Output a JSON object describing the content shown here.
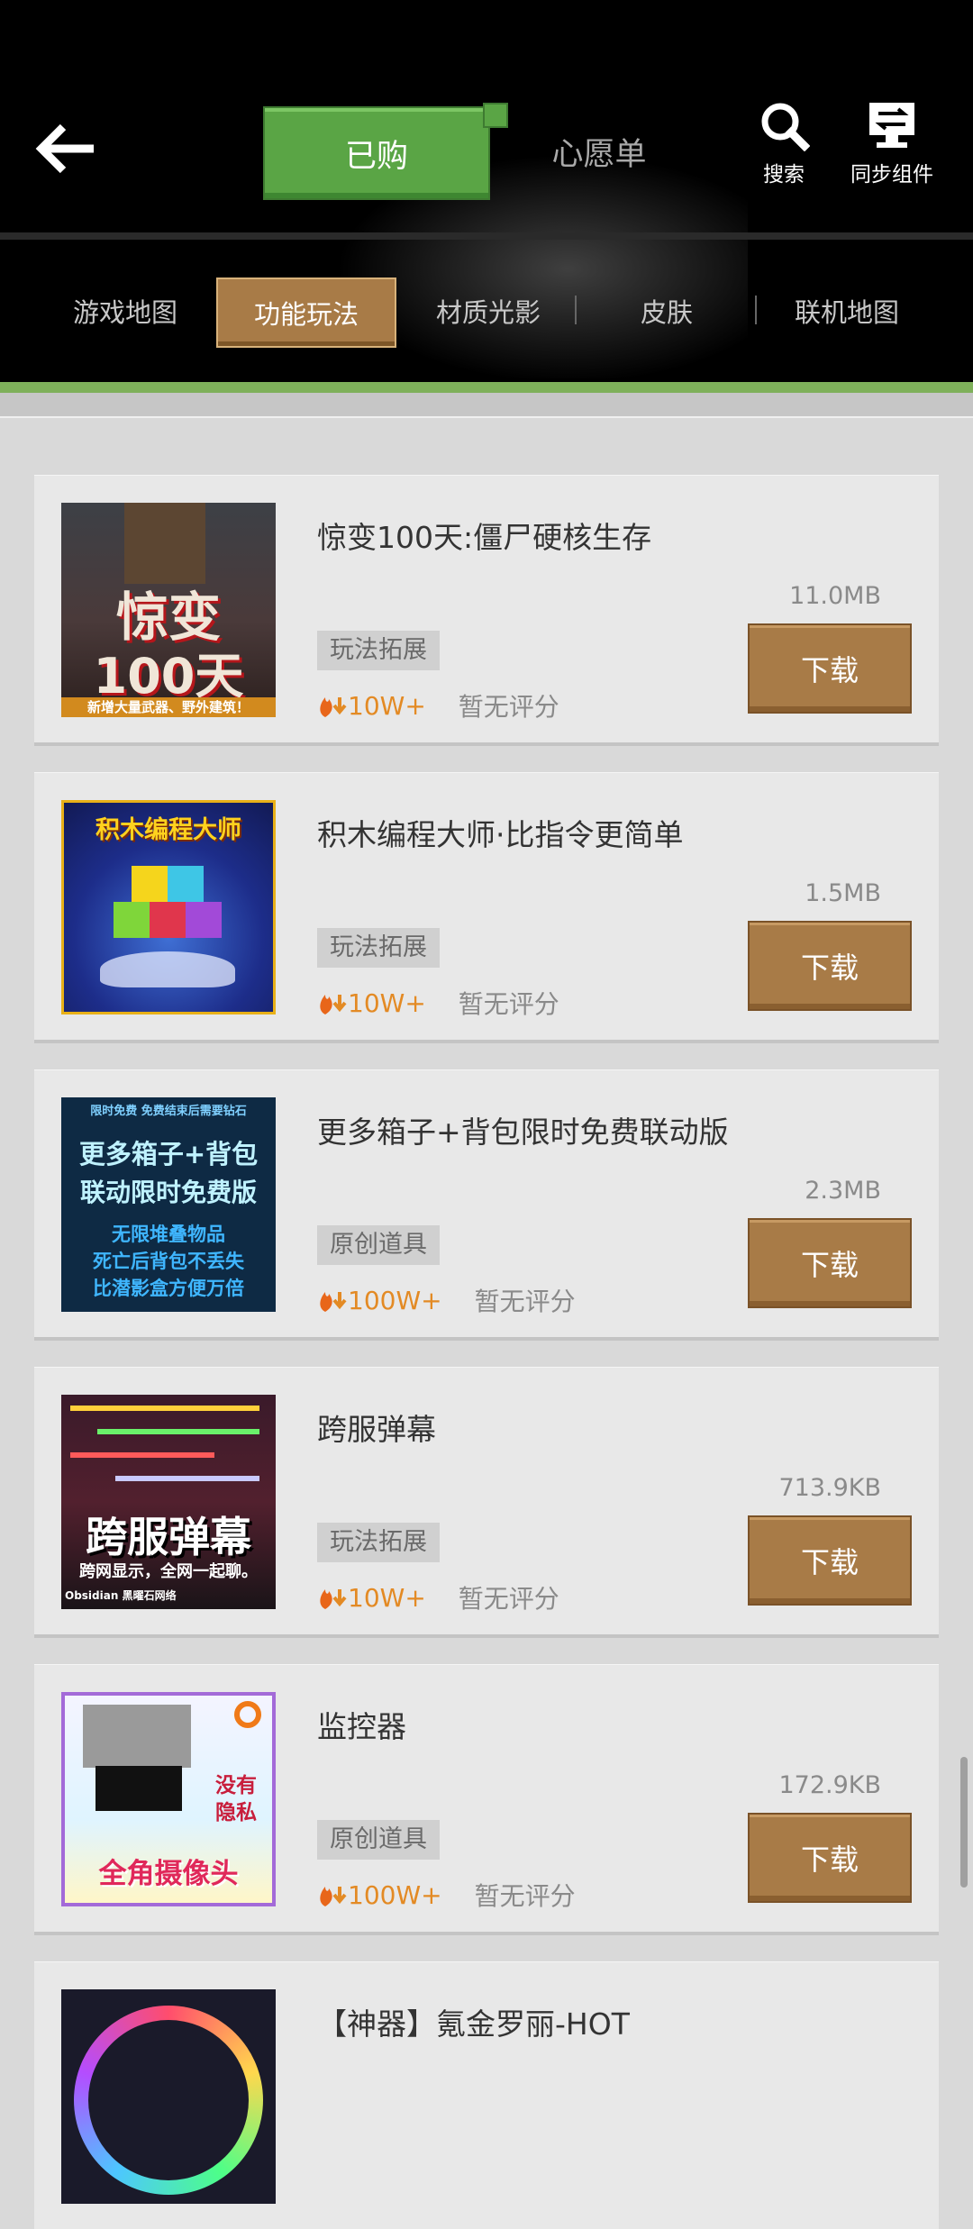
{
  "header": {
    "tabs": [
      {
        "label": "已购",
        "active": true
      },
      {
        "label": "心愿单",
        "active": false
      }
    ],
    "search_label": "搜索",
    "sync_label": "同步组件",
    "categories": [
      {
        "label": "游戏地图",
        "active": false
      },
      {
        "label": "功能玩法",
        "active": true
      },
      {
        "label": "材质光影",
        "active": false
      },
      {
        "label": "皮肤",
        "active": false
      },
      {
        "label": "联机地图",
        "active": false
      }
    ]
  },
  "items": [
    {
      "title": "惊变100天:僵尸硬核生存",
      "size": "11.0MB",
      "tag": "玩法拓展",
      "downloads": "10W+",
      "rating": "暂无评分",
      "button": "下载",
      "thumb": {
        "lines": [
          "惊变",
          "100天"
        ],
        "caption": "新增大量武器、野外建筑！"
      }
    },
    {
      "title": "积木编程大师·比指令更简单",
      "size": "1.5MB",
      "tag": "玩法拓展",
      "downloads": "10W+",
      "rating": "暂无评分",
      "button": "下载",
      "thumb": {
        "lines": [
          "积木编程大师"
        ],
        "caption": ""
      }
    },
    {
      "title": "更多箱子+背包限时免费联动版",
      "size": "2.3MB",
      "tag": "原创道具",
      "downloads": "100W+",
      "rating": "暂无评分",
      "button": "下载",
      "thumb": {
        "lines": [
          "限时免费 免费结束后需要钻石",
          "更多箱子+背包",
          "联动限时免费版",
          "无限堆叠物品",
          "死亡后背包不丢失",
          "比潜影盒方便万倍"
        ],
        "caption": ""
      }
    },
    {
      "title": "跨服弹幕",
      "size": "713.9KB",
      "tag": "玩法拓展",
      "downloads": "10W+",
      "rating": "暂无评分",
      "button": "下载",
      "thumb": {
        "lines": [
          "跨服弹幕",
          "跨网显示，全网一起聊。"
        ],
        "caption": "Obsidian 黑曜石网络"
      }
    },
    {
      "title": "监控器",
      "size": "172.9KB",
      "tag": "原创道具",
      "downloads": "100W+",
      "rating": "暂无评分",
      "button": "下载",
      "thumb": {
        "lines": [
          "没有",
          "隐私",
          "全角摄像头"
        ],
        "caption": ""
      }
    },
    {
      "title": "【神器】氪金罗丽-HOT",
      "size": "",
      "tag": "",
      "downloads": "",
      "rating": "",
      "button": "",
      "thumb": {
        "lines": [],
        "caption": ""
      }
    }
  ],
  "colors": {
    "green": "#5aa545",
    "brown": "#a87b47",
    "fire": "#e38a24"
  }
}
